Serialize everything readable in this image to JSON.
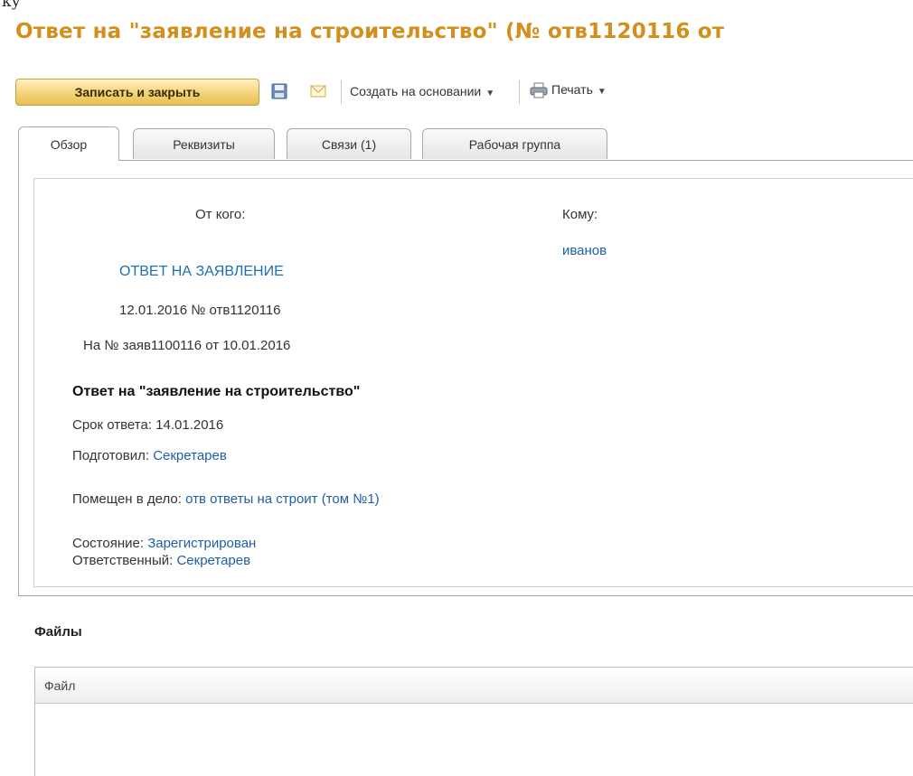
{
  "window": {
    "clipped_top_text": "ку",
    "title": "Ответ на \"заявление на строительство\" (№ отв1120116 от"
  },
  "toolbar": {
    "save_close_label": "Записать и закрыть",
    "create_based_label": "Создать на основании",
    "print_label": "Печать"
  },
  "tabs": [
    {
      "label": "Обзор"
    },
    {
      "label": "Реквизиты"
    },
    {
      "label": "Связи (1)"
    },
    {
      "label": "Рабочая группа"
    }
  ],
  "overview": {
    "from_label": "От кого:",
    "to_label": "Кому:",
    "to_value": "иванов",
    "doc_kind": "ОТВЕТ НА ЗАЯВЛЕНИЕ",
    "reg_line": "12.01.2016 № отв1120116",
    "ref_line": "На № заяв1100116 от 10.01.2016",
    "subject": "Ответ на \"заявление на строительство\"",
    "deadline_label": "Срок ответа:",
    "deadline_value": "14.01.2016",
    "prepared_label": "Подготовил:",
    "prepared_value": "Секретарев",
    "case_label": "Помещен в дело:",
    "case_value": "отв ответы на строит (том №1)",
    "state_label": "Состояние:",
    "state_value": "Зарегистрирован",
    "responsible_label": "Ответственный:",
    "responsible_value": "Секретарев"
  },
  "files": {
    "section_title": "Файлы",
    "column_header": "Файл"
  },
  "colors": {
    "title": "#d28f1c",
    "link": "#1f5fa6",
    "primary_button": "#f3d37a"
  }
}
